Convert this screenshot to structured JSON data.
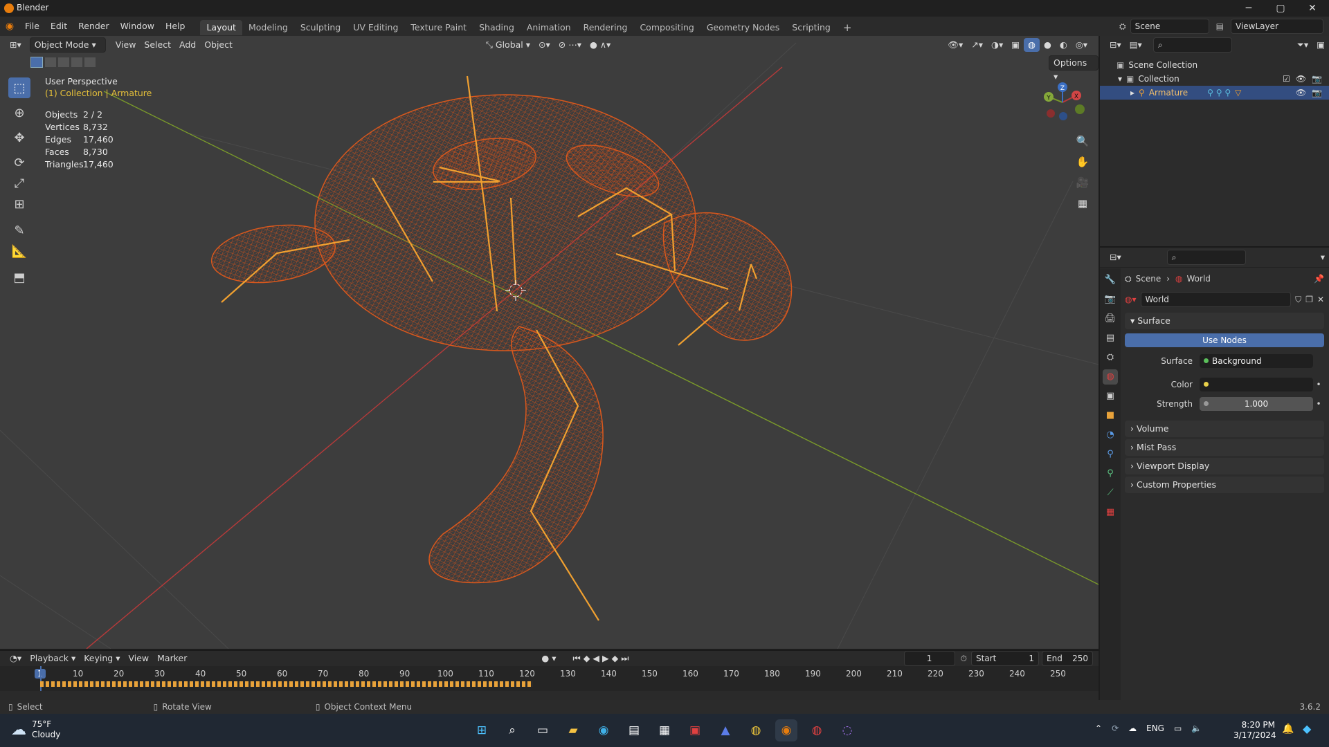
{
  "window": {
    "title": "Blender",
    "minimize": "─",
    "maximize": "▢",
    "close": "✕"
  },
  "menubar": {
    "menus": [
      "File",
      "Edit",
      "Render",
      "Window",
      "Help"
    ],
    "workspaces": [
      "Layout",
      "Modeling",
      "Sculpting",
      "UV Editing",
      "Texture Paint",
      "Shading",
      "Animation",
      "Rendering",
      "Compositing",
      "Geometry Nodes",
      "Scripting"
    ],
    "active_workspace": "Layout",
    "add_tab": "+",
    "scene": "Scene",
    "view_layer": "ViewLayer"
  },
  "viewport": {
    "mode": "Object Mode",
    "menus": [
      "View",
      "Select",
      "Add",
      "Object"
    ],
    "orientation": "Global",
    "options": "Options",
    "perspective": "User Perspective",
    "context": "(1) Collection | Armature",
    "stats": [
      {
        "label": "Objects",
        "value": "2 / 2"
      },
      {
        "label": "Vertices",
        "value": "8,732"
      },
      {
        "label": "Edges",
        "value": "17,460"
      },
      {
        "label": "Faces",
        "value": "8,730"
      },
      {
        "label": "Triangles",
        "value": "17,460"
      }
    ],
    "gizmo": {
      "x": "X",
      "y": "Y",
      "z": "Z"
    }
  },
  "outliner": {
    "rows": [
      {
        "label": "Scene Collection"
      },
      {
        "label": "Collection"
      },
      {
        "label": "Armature"
      }
    ]
  },
  "properties": {
    "breadcrumb": [
      "Scene",
      "World"
    ],
    "world_name": "World",
    "panels": {
      "surface": "Surface",
      "use_nodes": "Use Nodes",
      "surface_label": "Surface",
      "surface_value": "Background",
      "color_label": "Color",
      "strength_label": "Strength",
      "strength_value": "1.000",
      "collapsed": [
        "Volume",
        "Mist Pass",
        "Viewport Display",
        "Custom Properties"
      ]
    }
  },
  "timeline": {
    "menus": [
      "Playback",
      "Keying",
      "View",
      "Marker"
    ],
    "current_frame": "1",
    "start_label": "Start",
    "start": "1",
    "end_label": "End",
    "end": "250",
    "ticks": [
      "1",
      "10",
      "20",
      "30",
      "40",
      "50",
      "60",
      "70",
      "80",
      "90",
      "100",
      "110",
      "120",
      "130",
      "140",
      "150",
      "160",
      "170",
      "180",
      "190",
      "200",
      "210",
      "220",
      "230",
      "240",
      "250"
    ]
  },
  "statusbar": {
    "items": [
      "Select",
      "Rotate View",
      "Object Context Menu"
    ],
    "version": "3.6.2"
  },
  "taskbar": {
    "weather_temp": "75°F",
    "weather_desc": "Cloudy",
    "lang": "ENG",
    "time": "8:20 PM",
    "date": "3/17/2024"
  },
  "colors": {
    "accent": "#4a6eaa",
    "mesh": "#e25a1c",
    "bones": "#f0a030",
    "x_axis": "#b83a3a",
    "y_axis": "#7a9a2a"
  }
}
